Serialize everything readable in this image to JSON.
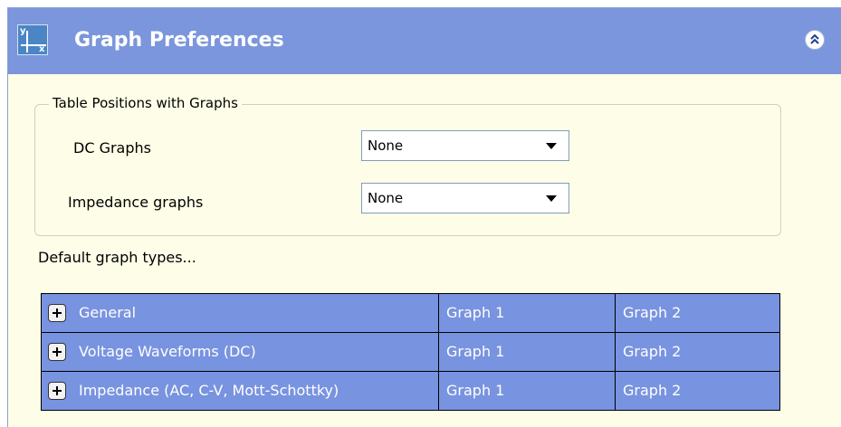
{
  "header": {
    "title": "Graph Preferences",
    "icon": "graph-axes-icon",
    "icon_labels": {
      "y": "y",
      "x": "x"
    },
    "collapse_icon": "double-chevron-up-icon",
    "background_color": "#7b96dc"
  },
  "positions_group": {
    "legend": "Table Positions with Graphs",
    "dc_graphs": {
      "label": "DC Graphs",
      "value": "None"
    },
    "impedance_graphs": {
      "label": "Impedance graphs",
      "value": "None"
    }
  },
  "default_types": {
    "label": "Default graph types...",
    "rows": [
      {
        "name": "General",
        "graph1": "Graph 1",
        "graph2": "Graph 2"
      },
      {
        "name": "Voltage Waveforms (DC)",
        "graph1": "Graph 1",
        "graph2": "Graph 2"
      },
      {
        "name": "Impedance (AC, C-V, Mott-Schottky)",
        "graph1": "Graph 1",
        "graph2": "Graph 2"
      }
    ]
  },
  "colors": {
    "panel_background": "#fefee8",
    "table_row_background": "#7893e0"
  }
}
